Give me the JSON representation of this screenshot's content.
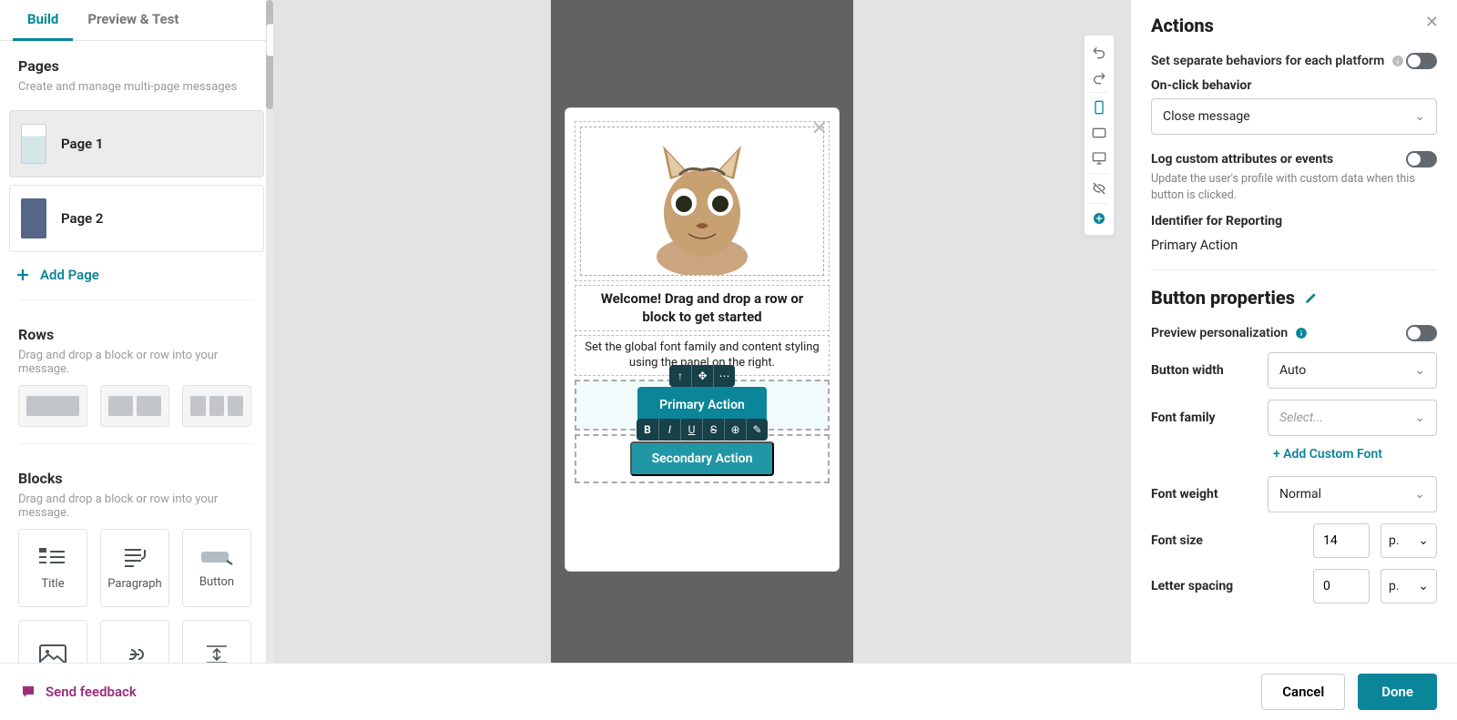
{
  "tabs": {
    "build": "Build",
    "preview": "Preview & Test"
  },
  "pages": {
    "heading": "Pages",
    "sub": "Create and manage multi-page messages",
    "items": [
      {
        "label": "Page 1"
      },
      {
        "label": "Page 2"
      }
    ],
    "add": "Add Page"
  },
  "rows": {
    "heading": "Rows",
    "sub": "Drag and drop a block or row into your message."
  },
  "blocks": {
    "heading": "Blocks",
    "sub": "Drag and drop a block or row into your message.",
    "items": [
      {
        "label": "Title"
      },
      {
        "label": "Paragraph"
      },
      {
        "label": "Button"
      }
    ]
  },
  "canvas": {
    "title": "Welcome! Drag and drop a row or block to get started",
    "body": "Set the global font family and content styling using the panel on the right.",
    "primary_btn": "Primary Action",
    "secondary_btn": "Secondary Action"
  },
  "actions_panel": {
    "heading": "Actions",
    "separate_platforms": "Set separate behaviors for each platform",
    "onclick_label": "On-click behavior",
    "onclick_value": "Close message",
    "log_label": "Log custom attributes or events",
    "log_help": "Update the user's profile with custom data when this button is clicked.",
    "identifier_label": "Identifier for Reporting",
    "identifier_value": "Primary Action"
  },
  "button_props": {
    "heading": "Button properties",
    "preview_personalization": "Preview personalization",
    "width_label": "Button width",
    "width_value": "Auto",
    "font_family_label": "Font family",
    "font_family_placeholder": "Select...",
    "add_custom_font": "+ Add Custom Font",
    "font_weight_label": "Font weight",
    "font_weight_value": "Normal",
    "font_size_label": "Font size",
    "font_size_value": "14",
    "font_size_unit": "p.",
    "letter_spacing_label": "Letter spacing",
    "letter_spacing_value": "0",
    "letter_spacing_unit": "p."
  },
  "footer": {
    "feedback": "Send feedback",
    "cancel": "Cancel",
    "done": "Done"
  }
}
